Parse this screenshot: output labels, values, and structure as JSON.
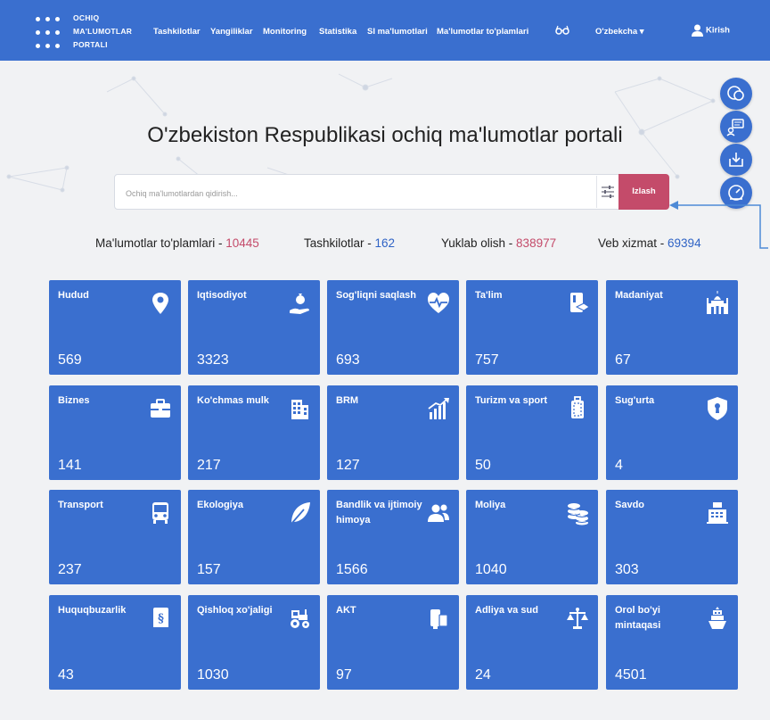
{
  "header": {
    "logo_lines": [
      "OCHIQ",
      "MA'LUMOTLAR",
      "PORTALI"
    ],
    "nav": [
      "Tashkilotlar",
      "Yangiliklar",
      "Monitoring",
      "Statistika",
      "SI ma'lumotlari",
      "Ma'lumotlar to'plamlari"
    ],
    "language": "O'zbekcha",
    "login": "Kirish"
  },
  "hero": {
    "title": "O'zbekiston Respublikasi ochiq ma'lumotlar portali",
    "search_placeholder": "Ochiq ma'lumotlardan qidirish...",
    "search_button": "Izlash"
  },
  "stats": [
    {
      "label": "Ma'lumotlar to'plamlari - ",
      "value": "10445",
      "color": "#c44b6a"
    },
    {
      "label": "Tashkilotlar - ",
      "value": "162",
      "color": "#2f63c5"
    },
    {
      "label": "Yuklab olish - ",
      "value": "838977",
      "color": "#c44b6a"
    },
    {
      "label": "Veb xizmat - ",
      "value": "69394",
      "color": "#2f63c5"
    }
  ],
  "categories": [
    {
      "title": "Hudud",
      "count": "569",
      "icon": "location-pin-icon"
    },
    {
      "title": "Iqtisodiyot",
      "count": "3323",
      "icon": "money-hand-icon"
    },
    {
      "title": "Sog'liqni saqlash",
      "count": "693",
      "icon": "heart-pulse-icon"
    },
    {
      "title": "Ta'lim",
      "count": "757",
      "icon": "graduation-book-icon"
    },
    {
      "title": "Madaniyat",
      "count": "67",
      "icon": "mosque-icon"
    },
    {
      "title": "Biznes",
      "count": "141",
      "icon": "briefcase-icon"
    },
    {
      "title": "Ko'chmas mulk",
      "count": "217",
      "icon": "building-icon"
    },
    {
      "title": "BRM",
      "count": "127",
      "icon": "growth-chart-icon"
    },
    {
      "title": "Turizm va sport",
      "count": "50",
      "icon": "suitcase-icon"
    },
    {
      "title": "Sug'urta",
      "count": "4",
      "icon": "shield-keyhole-icon"
    },
    {
      "title": "Transport",
      "count": "237",
      "icon": "bus-icon"
    },
    {
      "title": "Ekologiya",
      "count": "157",
      "icon": "leaf-icon"
    },
    {
      "title": "Bandlik va ijtimoiy himoya",
      "count": "1566",
      "icon": "people-icon"
    },
    {
      "title": "Moliya",
      "count": "1040",
      "icon": "coins-stack-icon"
    },
    {
      "title": "Savdo",
      "count": "303",
      "icon": "cash-register-icon"
    },
    {
      "title": "Huquqbuzarlik",
      "count": "43",
      "icon": "law-book-icon"
    },
    {
      "title": "Qishloq xo'jaligi",
      "count": "1030",
      "icon": "tractor-icon"
    },
    {
      "title": "AKT",
      "count": "97",
      "icon": "devices-icon"
    },
    {
      "title": "Adliya va sud",
      "count": "24",
      "icon": "scales-icon"
    },
    {
      "title": "Orol bo'yi mintaqasi",
      "count": "4501",
      "icon": "ship-icon"
    }
  ],
  "side_buttons": [
    "chat-bubbles-icon",
    "feedback-icon",
    "download-icon",
    "speedometer-icon"
  ],
  "colors": {
    "primary": "#3a6fcf",
    "accent": "#c44b6a"
  }
}
